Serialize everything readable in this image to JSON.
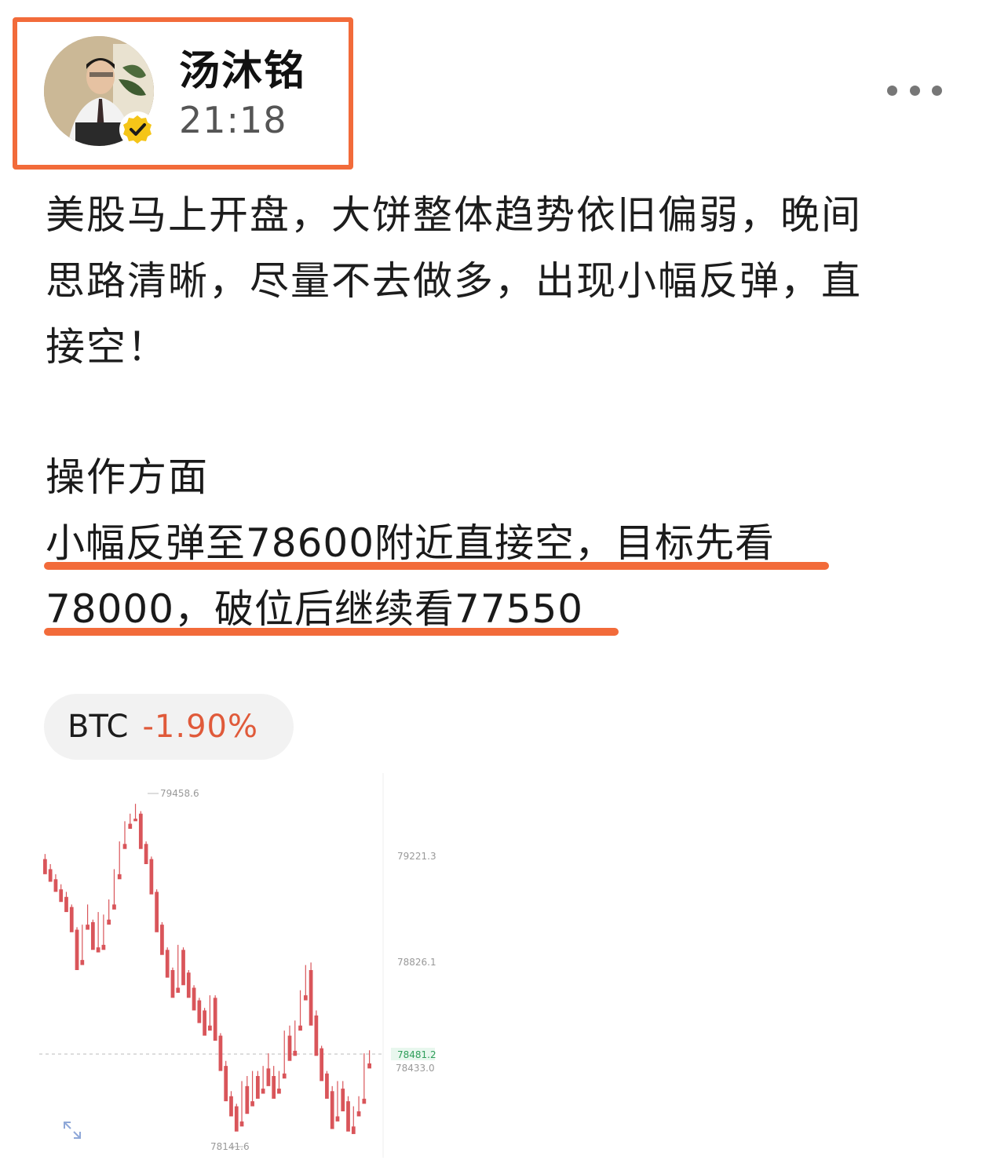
{
  "post": {
    "author": "汤沐铭",
    "time": "21:18",
    "body_lines": [
      "美股马上开盘，大饼整体趋势依旧偏弱，晚间",
      "思路清晰，尽量不去做多，出现小幅反弹，直",
      "接空！"
    ],
    "section_title": "操作方面",
    "highlight_lines": [
      "小幅反弹至78600附近直接空，目标先看",
      "78000，破位后继续看77550"
    ]
  },
  "ticker": {
    "symbol": "BTC",
    "change": "-1.90%"
  },
  "colors": {
    "highlight": "#f26b3a",
    "up": "#3cbf6a",
    "down": "#d9555a",
    "negative_text": "#e05a3a"
  },
  "chart_data": {
    "type": "candlestick",
    "price_labels": {
      "high": "79458.6",
      "level1": "79221.3",
      "level2": "78826.1",
      "current": "78481.2",
      "level3": "78433.0",
      "low": "78141.6"
    },
    "ylim": [
      78100,
      79500
    ],
    "candles": [
      [
        79240,
        79260,
        79190,
        79180
      ],
      [
        79200,
        79220,
        79160,
        79150
      ],
      [
        79160,
        79180,
        79120,
        79110
      ],
      [
        79120,
        79140,
        79090,
        79070
      ],
      [
        79090,
        79110,
        79040,
        79030
      ],
      [
        79050,
        79060,
        78960,
        78950
      ],
      [
        78960,
        78970,
        78820,
        78800
      ],
      [
        78840,
        78980,
        78830,
        78820
      ],
      [
        78980,
        79060,
        78970,
        78960
      ],
      [
        78990,
        79000,
        78890,
        78880
      ],
      [
        78890,
        79030,
        78880,
        78870
      ],
      [
        78900,
        79020,
        78890,
        78880
      ],
      [
        79000,
        79080,
        78990,
        78980
      ],
      [
        79060,
        79200,
        79050,
        79040
      ],
      [
        79180,
        79310,
        79170,
        79160
      ],
      [
        79300,
        79390,
        79290,
        79280
      ],
      [
        79380,
        79420,
        79370,
        79360
      ],
      [
        79400,
        79459,
        79395,
        79390
      ],
      [
        79420,
        79430,
        79290,
        79280
      ],
      [
        79300,
        79310,
        79240,
        79220
      ],
      [
        79240,
        79250,
        79120,
        79100
      ],
      [
        79110,
        79120,
        78970,
        78950
      ],
      [
        78980,
        78990,
        78880,
        78860
      ],
      [
        78880,
        78890,
        78790,
        78770
      ],
      [
        78800,
        78810,
        78700,
        78690
      ],
      [
        78730,
        78900,
        78720,
        78710
      ],
      [
        78880,
        78890,
        78760,
        78740
      ],
      [
        78790,
        78800,
        78700,
        78690
      ],
      [
        78730,
        78740,
        78650,
        78640
      ],
      [
        78680,
        78690,
        78600,
        78590
      ],
      [
        78640,
        78650,
        78560,
        78540
      ],
      [
        78580,
        78700,
        78570,
        78560
      ],
      [
        78690,
        78700,
        78530,
        78520
      ],
      [
        78540,
        78550,
        78420,
        78400
      ],
      [
        78420,
        78440,
        78300,
        78280
      ],
      [
        78300,
        78320,
        78240,
        78220
      ],
      [
        78260,
        78270,
        78180,
        78160
      ],
      [
        78200,
        78360,
        78190,
        78180
      ],
      [
        78340,
        78380,
        78250,
        78230
      ],
      [
        78280,
        78400,
        78270,
        78260
      ],
      [
        78380,
        78400,
        78310,
        78290
      ],
      [
        78330,
        78420,
        78320,
        78310
      ],
      [
        78410,
        78470,
        78360,
        78340
      ],
      [
        78380,
        78420,
        78300,
        78290
      ],
      [
        78330,
        78400,
        78320,
        78310
      ],
      [
        78390,
        78560,
        78380,
        78370
      ],
      [
        78540,
        78580,
        78460,
        78440
      ],
      [
        78480,
        78600,
        78470,
        78460
      ],
      [
        78580,
        78720,
        78570,
        78560
      ],
      [
        78700,
        78820,
        78690,
        78680
      ],
      [
        78800,
        78830,
        78600,
        78580
      ],
      [
        78620,
        78640,
        78480,
        78460
      ],
      [
        78490,
        78500,
        78380,
        78360
      ],
      [
        78390,
        78400,
        78300,
        78290
      ],
      [
        78320,
        78340,
        78190,
        78170
      ],
      [
        78220,
        78360,
        78210,
        78200
      ],
      [
        78330,
        78360,
        78250,
        78240
      ],
      [
        78280,
        78300,
        78200,
        78160
      ],
      [
        78180,
        78260,
        78160,
        78150
      ],
      [
        78240,
        78300,
        78230,
        78220
      ],
      [
        78290,
        78470,
        78280,
        78270
      ],
      [
        78430,
        78482,
        78420,
        78410
      ]
    ]
  }
}
